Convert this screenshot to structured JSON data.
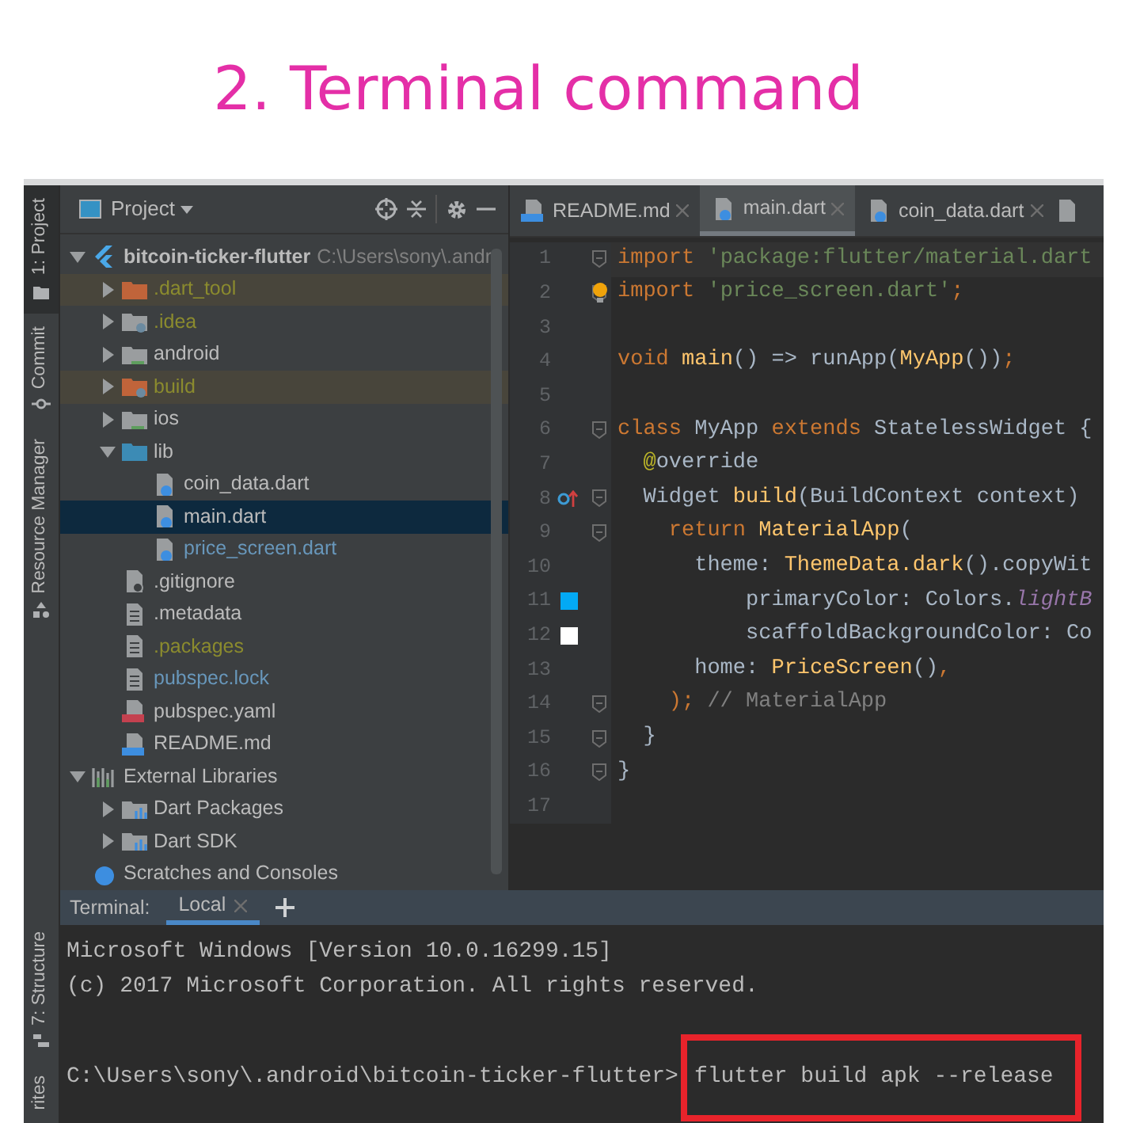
{
  "title": "2. Terminal command",
  "tool_strip": {
    "top": [
      {
        "label": "1: Project",
        "selected": true
      },
      {
        "label": "Commit",
        "selected": false
      },
      {
        "label": "Resource Manager",
        "selected": false
      }
    ],
    "bottom": [
      {
        "label": "7: Structure"
      },
      {
        "label": "rites"
      }
    ]
  },
  "project_panel": {
    "title": "Project",
    "tree": [
      {
        "label": "bitcoin-ticker-flutter",
        "path": "C:\\Users\\sony\\.andr",
        "kind": "flutter",
        "ignored": false,
        "modified": false,
        "expanded": true,
        "selected": false,
        "excluded": false,
        "children": [
          {
            "label": ".dart_tool",
            "kind": "excluded-folder",
            "ignored": true,
            "modified": false,
            "expanded": false,
            "selected": false,
            "excluded": true
          },
          {
            "label": ".idea",
            "kind": "config-folder",
            "ignored": true,
            "modified": false,
            "expanded": false,
            "selected": false,
            "excluded": false
          },
          {
            "label": "android",
            "kind": "module-folder",
            "ignored": false,
            "modified": false,
            "expanded": false,
            "selected": false,
            "excluded": false
          },
          {
            "label": "build",
            "kind": "excluded-config-folder",
            "ignored": true,
            "modified": false,
            "expanded": false,
            "selected": false,
            "excluded": true
          },
          {
            "label": "ios",
            "kind": "module-folder",
            "ignored": false,
            "modified": false,
            "expanded": false,
            "selected": false,
            "excluded": false
          },
          {
            "label": "lib",
            "kind": "source-folder",
            "ignored": false,
            "modified": false,
            "expanded": true,
            "selected": false,
            "excluded": false,
            "children": [
              {
                "label": "coin_data.dart",
                "kind": "dart",
                "ignored": false,
                "modified": false,
                "selected": false,
                "excluded": false
              },
              {
                "label": "main.dart",
                "kind": "dart",
                "ignored": false,
                "modified": false,
                "selected": true,
                "excluded": false
              },
              {
                "label": "price_screen.dart",
                "kind": "dart",
                "ignored": false,
                "modified": true,
                "selected": false,
                "excluded": false
              }
            ]
          },
          {
            "label": ".gitignore",
            "kind": "ignore-file",
            "ignored": false,
            "modified": false,
            "selected": false,
            "excluded": false
          },
          {
            "label": ".metadata",
            "kind": "file",
            "ignored": false,
            "modified": false,
            "selected": false,
            "excluded": false
          },
          {
            "label": ".packages",
            "kind": "file",
            "ignored": true,
            "modified": false,
            "selected": false,
            "excluded": false
          },
          {
            "label": "pubspec.lock",
            "kind": "file",
            "ignored": false,
            "modified": true,
            "selected": false,
            "excluded": false
          },
          {
            "label": "pubspec.yaml",
            "kind": "yaml",
            "ignored": false,
            "modified": false,
            "selected": false,
            "excluded": false
          },
          {
            "label": "README.md",
            "kind": "markdown",
            "ignored": false,
            "modified": false,
            "selected": false,
            "excluded": false
          }
        ]
      },
      {
        "label": "External Libraries",
        "kind": "libraries",
        "ignored": false,
        "modified": false,
        "expanded": true,
        "selected": false,
        "excluded": false,
        "children": [
          {
            "label": "Dart Packages",
            "kind": "library",
            "ignored": false,
            "modified": false,
            "expanded": false,
            "selected": false,
            "excluded": false
          },
          {
            "label": "Dart SDK",
            "kind": "library",
            "ignored": false,
            "modified": false,
            "expanded": false,
            "selected": false,
            "excluded": false
          }
        ]
      },
      {
        "label": "Scratches and Consoles",
        "kind": "scratches",
        "ignored": false,
        "modified": false,
        "selected": false,
        "excluded": false
      }
    ]
  },
  "editor": {
    "tabs": [
      {
        "label": "README.md",
        "kind": "markdown",
        "selected": false
      },
      {
        "label": "main.dart",
        "kind": "dart",
        "selected": true
      },
      {
        "label": "coin_data.dart",
        "kind": "dart",
        "selected": false
      }
    ],
    "lines": [
      {
        "number": "1",
        "current": true,
        "fold": true,
        "tokens": [
          {
            "kind": "keyword",
            "s": "import "
          },
          {
            "kind": "string",
            "s": "'package:flutter/material.dart"
          }
        ]
      },
      {
        "number": "2",
        "current": false,
        "fold": true,
        "kind": "bulb",
        "tokens": [
          {
            "kind": "keyword",
            "s": "import "
          },
          {
            "kind": "string",
            "s": "'price_screen.dart'"
          },
          {
            "kind": "keyword",
            "s": ";"
          }
        ]
      },
      {
        "number": "3",
        "current": false,
        "fold": false
      },
      {
        "number": "4",
        "current": false,
        "fold": false,
        "tokens": [
          {
            "kind": "keyword",
            "s": "void "
          },
          {
            "kind": "function",
            "s": "main"
          },
          {
            "kind": "plain",
            "s": "() => runApp("
          },
          {
            "kind": "function",
            "s": "MyApp"
          },
          {
            "kind": "plain",
            "s": "())"
          },
          {
            "kind": "keyword",
            "s": ";"
          }
        ]
      },
      {
        "number": "5",
        "current": false,
        "fold": false
      },
      {
        "number": "6",
        "current": false,
        "fold": true,
        "tokens": [
          {
            "kind": "keyword",
            "s": "class "
          },
          {
            "kind": "plain",
            "s": "MyApp "
          },
          {
            "kind": "keyword",
            "s": "extends "
          },
          {
            "kind": "plain",
            "s": "StatelessWidget {"
          }
        ]
      },
      {
        "number": "7",
        "current": false,
        "fold": false,
        "tokens": [
          {
            "kind": "annotation",
            "s": "  @"
          },
          {
            "kind": "plain",
            "s": "override"
          }
        ]
      },
      {
        "number": "8",
        "current": false,
        "fold": true,
        "kind": "override",
        "tokens": [
          {
            "kind": "plain",
            "s": "  Widget "
          },
          {
            "kind": "function",
            "s": "build"
          },
          {
            "kind": "plain",
            "s": "(BuildContext context)"
          }
        ]
      },
      {
        "number": "9",
        "current": false,
        "fold": true,
        "tokens": [
          {
            "kind": "keyword",
            "s": "    return "
          },
          {
            "kind": "function",
            "s": "MaterialApp"
          },
          {
            "kind": "plain",
            "s": "("
          }
        ]
      },
      {
        "number": "10",
        "current": false,
        "fold": false,
        "tokens": [
          {
            "kind": "plain",
            "s": "      theme: "
          },
          {
            "kind": "function",
            "s": "ThemeData.dark"
          },
          {
            "kind": "plain",
            "s": "().copyWit"
          }
        ]
      },
      {
        "number": "11",
        "current": false,
        "fold": false,
        "kind": "swatch",
        "color": "#03a9f4",
        "tokens": [
          {
            "kind": "plain",
            "s": "          primaryColor: Colors."
          },
          {
            "kind": "field",
            "s": "lightB"
          }
        ]
      },
      {
        "number": "12",
        "current": false,
        "fold": false,
        "kind": "swatch",
        "color": "#ffffff",
        "tokens": [
          {
            "kind": "plain",
            "s": "          scaffoldBackgroundColor: Co"
          }
        ]
      },
      {
        "number": "13",
        "current": false,
        "fold": false,
        "tokens": [
          {
            "kind": "plain",
            "s": "      home: "
          },
          {
            "kind": "function",
            "s": "PriceScreen"
          },
          {
            "kind": "plain",
            "s": "()"
          },
          {
            "kind": "keyword",
            "s": ","
          }
        ]
      },
      {
        "number": "14",
        "current": false,
        "fold": true,
        "tokens": [
          {
            "kind": "keyword",
            "s": "    );"
          },
          {
            "kind": "comment",
            "s": " // MaterialApp"
          }
        ]
      },
      {
        "number": "15",
        "current": false,
        "fold": true,
        "tokens": [
          {
            "kind": "plain",
            "s": "  }"
          }
        ]
      },
      {
        "number": "16",
        "current": false,
        "fold": true,
        "tokens": [
          {
            "kind": "plain",
            "s": "}"
          }
        ]
      },
      {
        "number": "17",
        "current": false,
        "fold": false
      }
    ]
  },
  "terminal": {
    "label": "Terminal:",
    "tabs": [
      {
        "label": "Local",
        "selected": true
      }
    ],
    "lines": [
      {
        "kind": "output",
        "text": "Microsoft Windows [Version 10.0.16299.15]"
      },
      {
        "kind": "output",
        "text": "(c) 2017 Microsoft Corporation. All rights reserved."
      },
      {
        "kind": "blank"
      },
      {
        "kind": "prompt",
        "prompt": "C:\\Users\\sony\\.android\\bitcoin-ticker-flutter>",
        "command": "flutter build apk --release",
        "highlighted": true
      }
    ]
  }
}
